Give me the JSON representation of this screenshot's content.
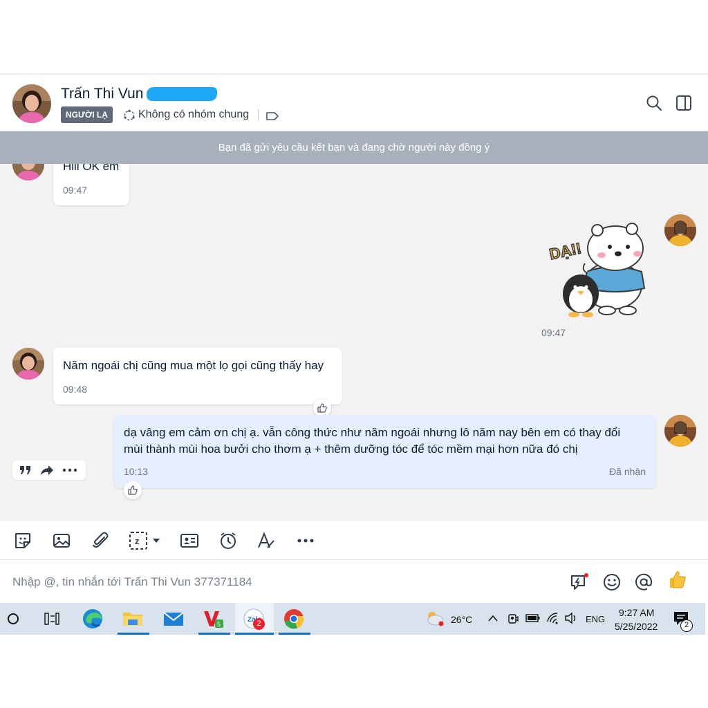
{
  "header": {
    "contact_name": "Trấn Thi Vun",
    "badge": "NGƯỜI LẠ",
    "group_status": "Không có nhóm chung"
  },
  "banner": {
    "text": "Bạn đã gửi yêu cầu kết bạn và đang chờ người này đồng ý"
  },
  "messages": [
    {
      "from": "contact",
      "text": "Hiii OK em",
      "time": "09:47"
    },
    {
      "from": "me",
      "sticker": "bear-and-penguin-da-sticker",
      "sticker_text": "DẠ!!",
      "time": "09:47"
    },
    {
      "from": "contact",
      "text": "Năm ngoái chị cũng mua một lọ gọi cũng thấy hay",
      "time": "09:48"
    },
    {
      "from": "me",
      "text": "dạ vâng em cảm ơn chị ạ. vẫn công thức như năm ngoái nhưng lô năm nay bên em có thay đổi mùi thành mùi hoa bưởi cho thơm ạ + thêm dưỡng tóc để tóc mềm mại hơn nữa đó chị",
      "time": "10:13",
      "status": "Đã nhận"
    }
  ],
  "composer": {
    "placeholder": "Nhập @, tin nhắn tới Trấn Thi Vun 377371184"
  },
  "taskbar": {
    "weather": "26°C",
    "language": "ENG",
    "time": "9:27 AM",
    "date": "5/25/2022",
    "zalo_badge": "2",
    "notification_count": "2"
  },
  "colors": {
    "accent_blue": "#1ea7f4",
    "my_bubble": "#e5efff",
    "banner_bg": "#a8b1bb",
    "chat_bg": "#f2f2f3"
  }
}
